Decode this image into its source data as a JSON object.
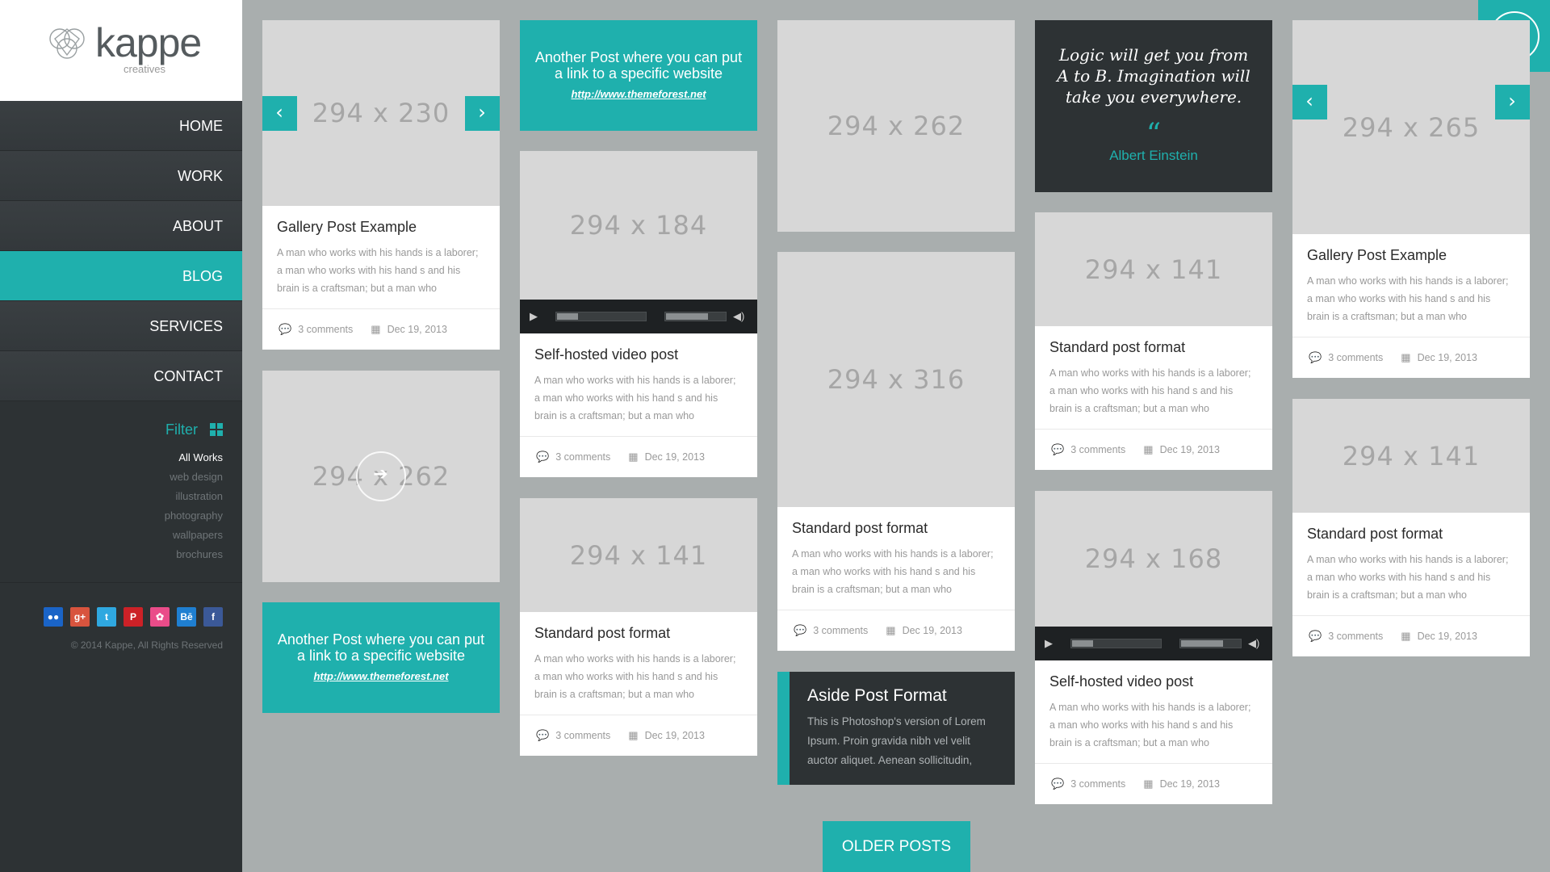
{
  "brand": {
    "name": "kappe",
    "tagline": "creatives"
  },
  "nav": [
    {
      "label": "HOME"
    },
    {
      "label": "WORK"
    },
    {
      "label": "ABOUT"
    },
    {
      "label": "BLOG"
    },
    {
      "label": "SERVICES"
    },
    {
      "label": "CONTACT"
    }
  ],
  "filter": {
    "title": "Filter",
    "items": [
      "All Works",
      "web design",
      "illustration",
      "photography",
      "wallpapers",
      "brochures"
    ]
  },
  "social": [
    {
      "icon": "flickr-icon",
      "glyph": "●●",
      "color": "#1a64c7"
    },
    {
      "icon": "google-plus-icon",
      "glyph": "g+",
      "color": "#d8543e"
    },
    {
      "icon": "twitter-icon",
      "glyph": "t",
      "color": "#2fa8e0"
    },
    {
      "icon": "pinterest-icon",
      "glyph": "P",
      "color": "#cc2127"
    },
    {
      "icon": "dribbble-icon",
      "glyph": "✿",
      "color": "#ea4c89"
    },
    {
      "icon": "behance-icon",
      "glyph": "Bē",
      "color": "#1f7fd1"
    },
    {
      "icon": "facebook-icon",
      "glyph": "f",
      "color": "#3b5998"
    }
  ],
  "copyright": "© 2014 Kappe, All Rights Reserved",
  "colors": {
    "accent": "#1fb0ad",
    "sidebar": "#2d3234",
    "background": "#a9aeae"
  },
  "posts": {
    "c1a": {
      "ph": "294 x 230",
      "title": "Gallery Post Example",
      "excerpt": "A man who works with his hands is a laborer; a man who works with his hand s and his brain is a craftsman; but a man who",
      "comments": "3 comments",
      "date": "Dec 19, 2013"
    },
    "c1b": {
      "ph": "294 x 262"
    },
    "c1c": {
      "text": "Another Post where you can put a link to a specific website",
      "url": "http://www.themeforest.net"
    },
    "c2a": {
      "text": "Another Post where you can put a link to a specific website",
      "url": "http://www.themeforest.net"
    },
    "c2b": {
      "ph": "294 x 184",
      "title": "Self-hosted video post",
      "excerpt": "A man who works with his hands is a laborer; a man who works with his hand s and his brain is a craftsman; but a man who",
      "comments": "3 comments",
      "date": "Dec 19, 2013"
    },
    "c2c": {
      "ph": "294 x 141",
      "title": "Standard post format",
      "excerpt": "A man who works with his hands is a laborer; a man who works with his hand s and his brain is a craftsman; but a man who",
      "comments": "3 comments",
      "date": "Dec 19, 2013"
    },
    "c3a": {
      "ph": "294 x 262"
    },
    "c3b": {
      "ph": "294 x 316",
      "title": "Standard post format",
      "excerpt": "A man who works with his hands is a laborer; a man who works with his hand s and his brain is a craftsman; but a man who",
      "comments": "3 comments",
      "date": "Dec 19, 2013"
    },
    "c3c": {
      "title": "Aside Post Format",
      "text": "This is Photoshop's version  of Lorem Ipsum. Proin gravida nibh vel velit auctor aliquet. Aenean sollicitudin,"
    },
    "c4a": {
      "quote": "Logic will get you from A to B. Imagination will take you everywhere.",
      "mark": "“",
      "author": "Albert Einstein"
    },
    "c4b": {
      "ph": "294 x 141",
      "title": "Standard post format",
      "excerpt": "A man who works with his hands is a laborer; a man who works with his hand s and his brain is a craftsman; but a man who",
      "comments": "3 comments",
      "date": "Dec 19, 2013"
    },
    "c4c": {
      "ph": "294 x 168",
      "title": "Self-hosted video post",
      "excerpt": "A man who works with his hands is a laborer; a man who works with his hand s and his brain is a craftsman; but a man who",
      "comments": "3 comments",
      "date": "Dec 19, 2013"
    },
    "c5a": {
      "ph": "294 x 265",
      "title": "Gallery Post Example",
      "excerpt": "A man who works with his hands is a laborer; a man who works with his hand s and his brain is a craftsman; but a man who",
      "comments": "3 comments",
      "date": "Dec 19, 2013"
    },
    "c5b": {
      "ph": "294 x 141",
      "title": "Standard post format",
      "excerpt": "A man who works with his hands is a laborer; a man who works with his hand s and his brain is a craftsman; but a man who",
      "comments": "3 comments",
      "date": "Dec 19, 2013"
    }
  },
  "older_posts": "OLDER POSTS"
}
